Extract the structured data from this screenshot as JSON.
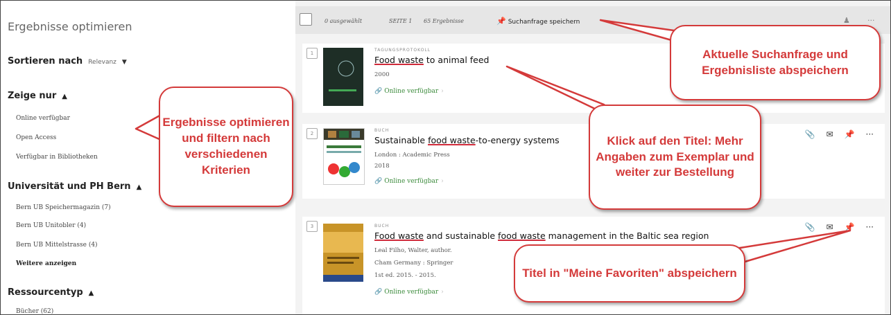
{
  "sidebar": {
    "title": "Ergebnisse optimieren",
    "sort_label": "Sortieren nach",
    "sort_value": "Relevanz",
    "show_only": {
      "heading": "Zeige nur",
      "items": [
        "Online verfügbar",
        "Open Access",
        "Verfügbar in Bibliotheken"
      ]
    },
    "university": {
      "heading": "Universität und PH Bern",
      "items": [
        "Bern UB Speichermagazin (7)",
        "Bern UB Unitobler (4)",
        "Bern UB Mittelstrasse (4)"
      ],
      "more": "Weitere anzeigen"
    },
    "resource_type": {
      "heading": "Ressourcentyp",
      "items": [
        "Bücher (62)"
      ]
    }
  },
  "topbar": {
    "selected": "0 ausgewählt",
    "page": "SEITE 1",
    "results": "65 Ergebnisse",
    "save_query": "Suchanfrage speichern"
  },
  "results": [
    {
      "index": "1",
      "type": "TAGUNGSPROTOKOLL",
      "title_parts": [
        "Food waste",
        " to animal feed"
      ],
      "lines": [
        "2000"
      ],
      "availability": "Online verfügbar"
    },
    {
      "index": "2",
      "type": "BUCH",
      "title_parts": [
        "Sustainable ",
        "food waste",
        "-to-energy systems"
      ],
      "lines": [
        "London : Academic Press",
        "2018"
      ],
      "availability": "Online verfügbar"
    },
    {
      "index": "3",
      "type": "BUCH",
      "title_parts": [
        "Food waste",
        " and sustainable ",
        "food waste",
        " management in the Baltic sea region"
      ],
      "lines": [
        "Leal Filho, Walter, author.",
        "Cham Germany : Springer",
        "1st ed. 2015. - 2015."
      ],
      "availability": "Online verfügbar"
    }
  ],
  "callouts": {
    "filter": "Ergebnisse optimieren und filtern nach verschiedenen Kriterien",
    "save": "Aktuelle Suchanfrage und Ergebnisliste abspeichern",
    "title": "Klick auf den Titel: Mehr Angaben zum Exemplar und weiter zur Bestellung",
    "favorites": "Titel in \"Meine Favoriten\" abspeichern"
  },
  "colors": {
    "callout_red": "#d43a3a",
    "available_green": "#3a8a3a"
  }
}
